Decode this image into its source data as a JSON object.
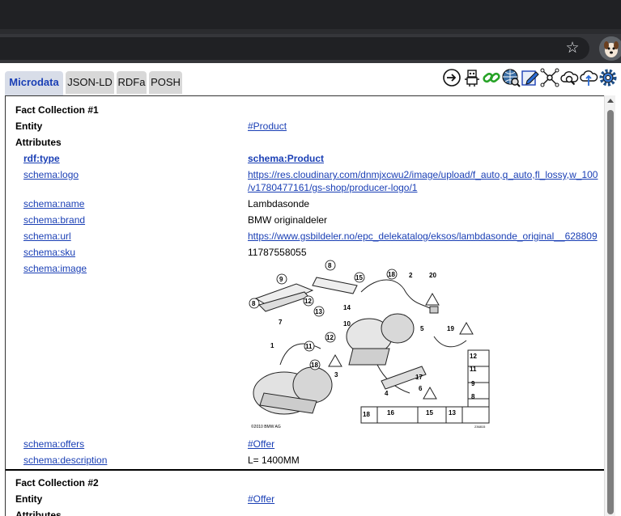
{
  "tabs": [
    {
      "label": "Microdata",
      "active": true
    },
    {
      "label": "JSON-LD"
    },
    {
      "label": "RDFa"
    },
    {
      "label": "POSH"
    }
  ],
  "toolbar_icons": [
    "login-icon",
    "robot-icon",
    "chain-link-icon",
    "globe-search-icon",
    "edit-icon",
    "network-icon",
    "cloud-search-icon",
    "cloud-upload-icon",
    "gear-icon"
  ],
  "collection1": {
    "title": "Fact Collection #1",
    "entity_label": "Entity",
    "entity_value": "#Product",
    "attributes_label": "Attributes",
    "rows": [
      {
        "prop": "rdf:type",
        "value": "schema:Product"
      },
      {
        "prop": "schema:logo",
        "value_line1": "https://res.cloudinary.com/dnmjxcwu2/image/upload/f_auto,q_auto,fl_lossy,w_100",
        "value_line2": "/v1780477161/gs-shop/producer-logo/1"
      },
      {
        "prop": "schema:name",
        "value": "Lambdasonde"
      },
      {
        "prop": "schema:brand",
        "value": "BMW originaldeler"
      },
      {
        "prop": "schema:url",
        "value": "https://www.gsbildeler.no/epc_delekatalog/eksos/lambdasonde_original__628809"
      },
      {
        "prop": "schema:sku",
        "value": "11787558055"
      },
      {
        "prop": "schema:image"
      },
      {
        "prop": "schema:offers",
        "value": "#Offer"
      },
      {
        "prop": "schema:description",
        "value": "L= 1400MM"
      }
    ],
    "image_caption": "©2010 BMW AG",
    "image_code": "236815",
    "callouts": [
      "1",
      "2",
      "3",
      "4",
      "5",
      "6",
      "7",
      "8",
      "9",
      "10",
      "11",
      "12",
      "13",
      "14",
      "15",
      "16",
      "17",
      "18",
      "19",
      "20"
    ]
  },
  "collection2": {
    "title": "Fact Collection #2",
    "entity_label": "Entity",
    "entity_value": "#Offer",
    "attributes_label": "Attributes"
  },
  "colors": {
    "link": "#1a3fb5",
    "chrome_dark": "#202124",
    "chrome_toolbar": "#35363a"
  }
}
